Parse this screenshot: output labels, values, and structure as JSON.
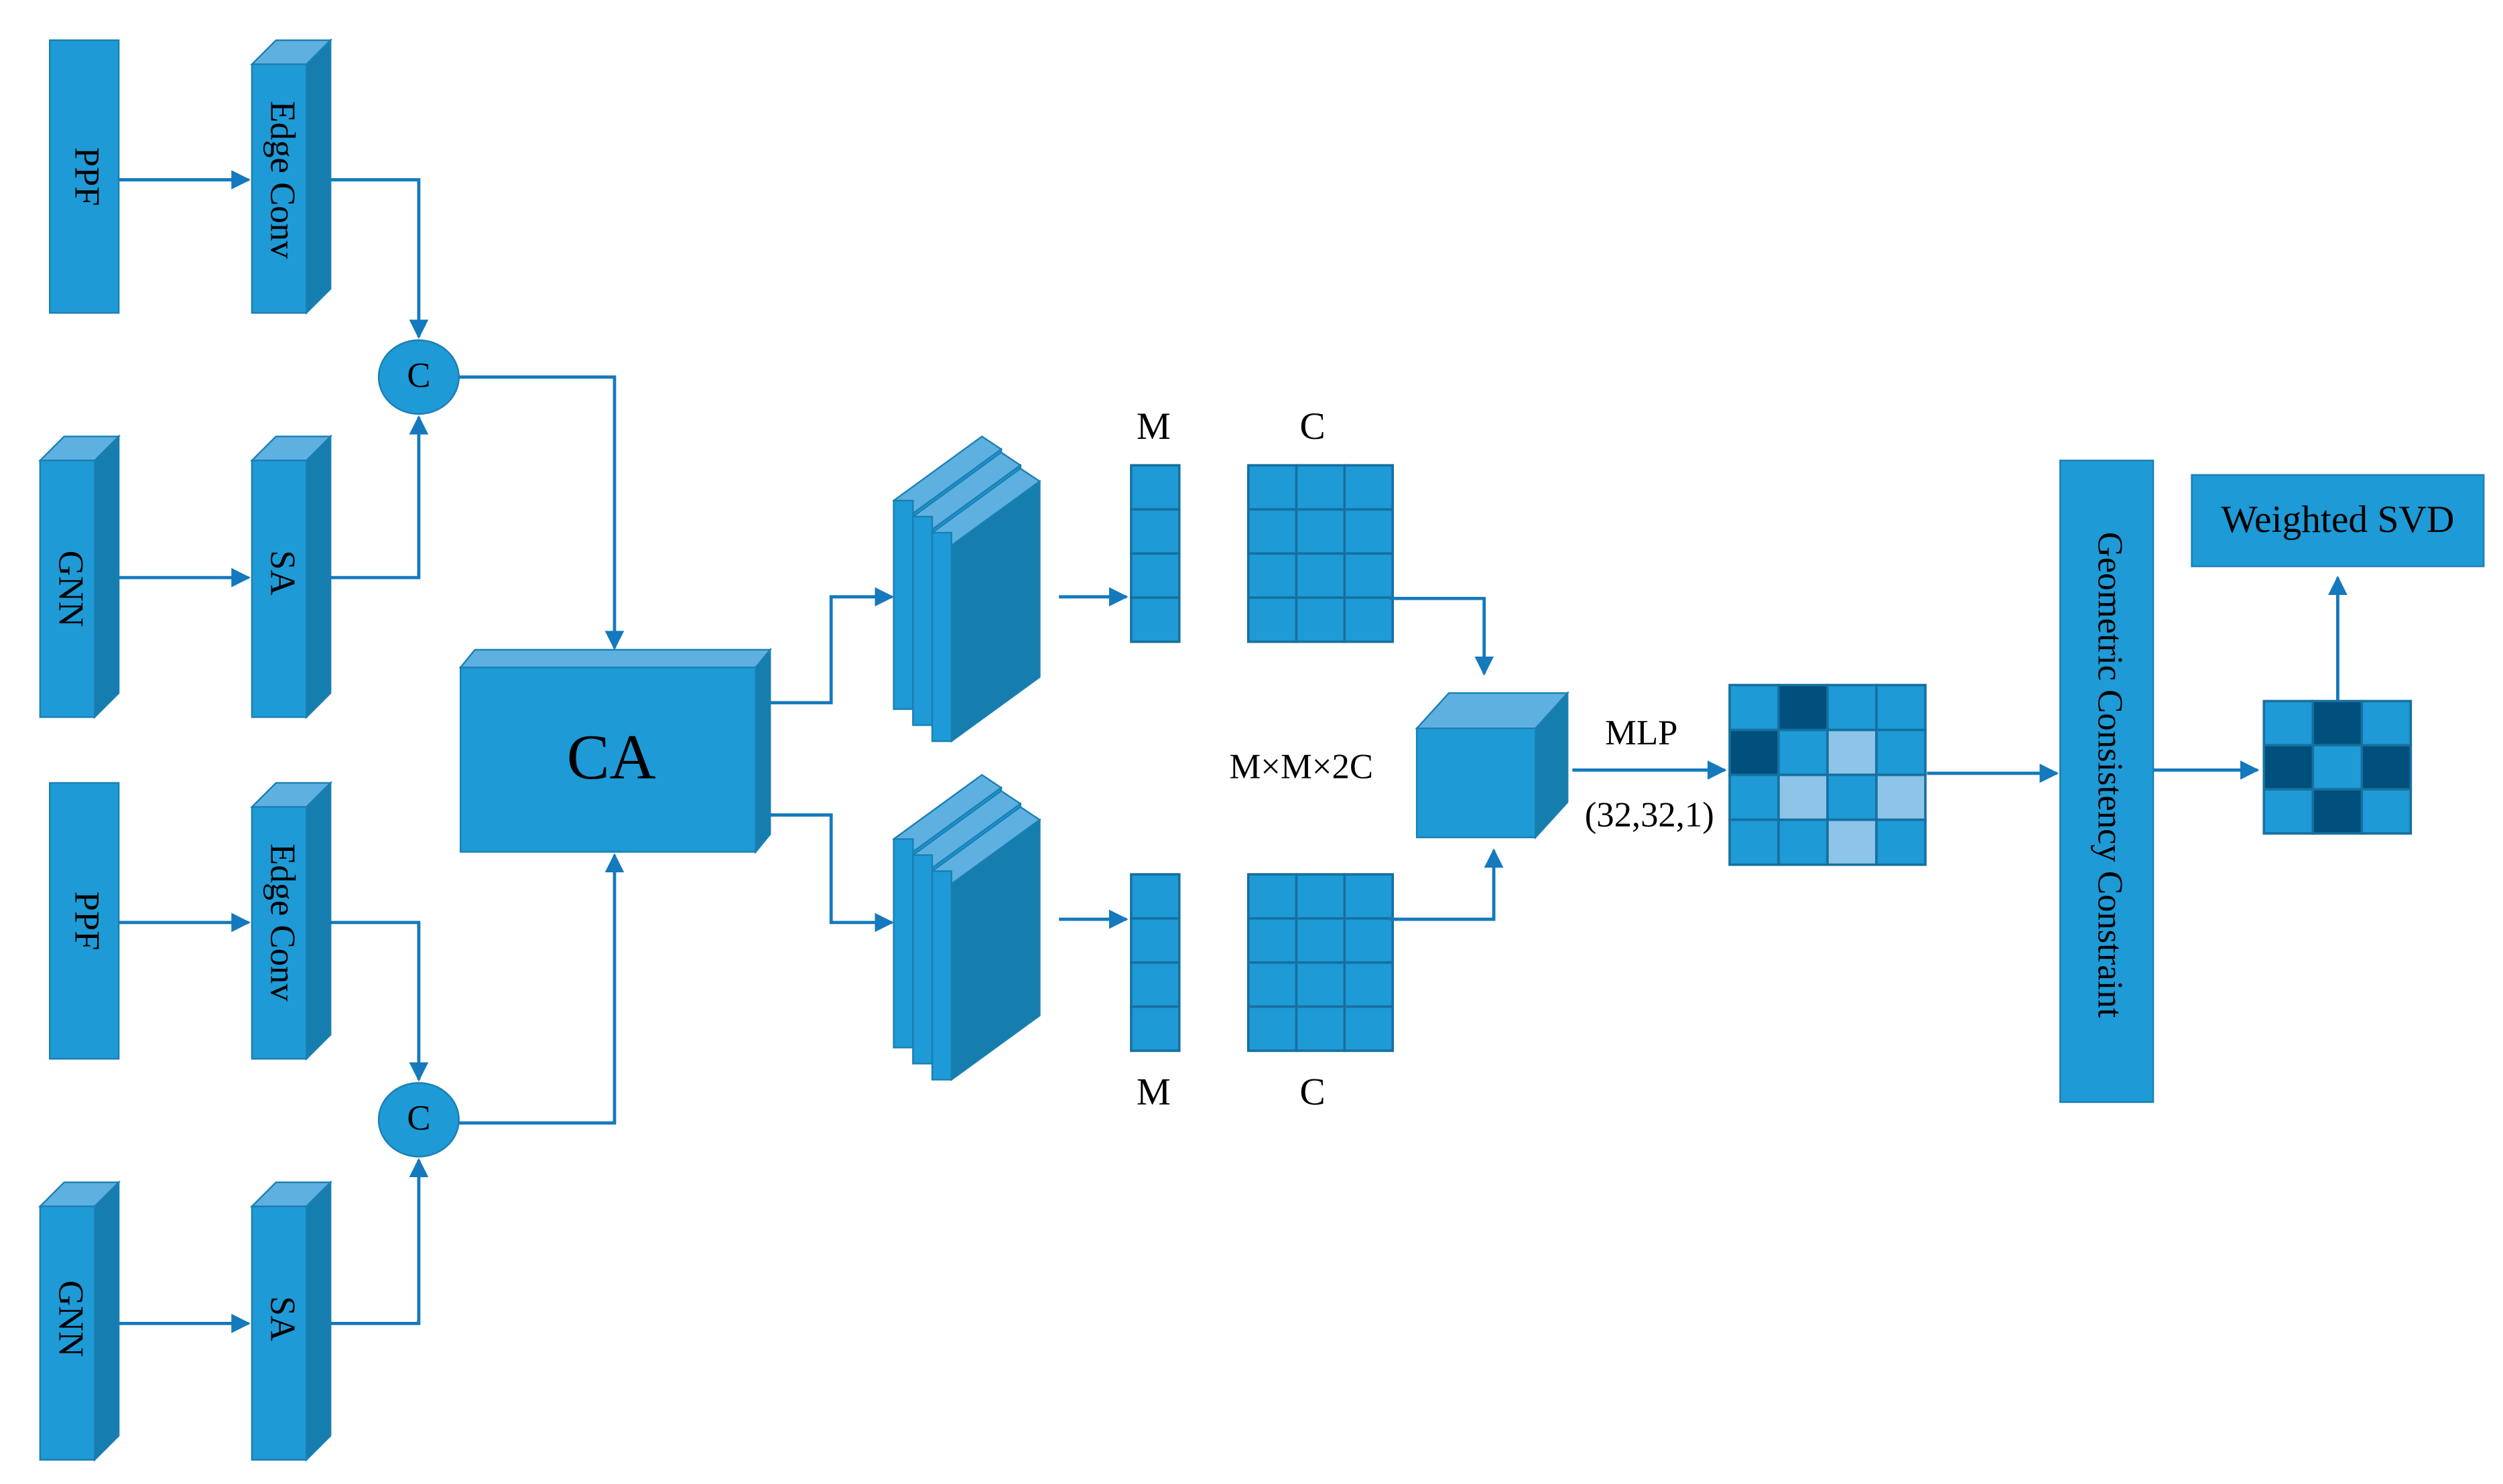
{
  "colors": {
    "face": "#1e9ad6",
    "top": "#5eb0e0",
    "side": "#167eae",
    "line": "#1479bd",
    "cell_mid": "#1e9ad6",
    "cell_dark": "#004f7c",
    "cell_light": "#8ec4e8"
  },
  "branches": [
    {
      "top_input": "PPF",
      "top_block": "Edge Conv",
      "bottom_input": "GNN",
      "bottom_block": "SA",
      "concat": "C"
    },
    {
      "top_input": "PPF",
      "top_block": "Edge Conv",
      "bottom_input": "GNN",
      "bottom_block": "SA",
      "concat": "C"
    }
  ],
  "ca_block": "CA",
  "feature_upper": {
    "m_label": "M",
    "c_label": "C"
  },
  "feature_lower": {
    "m_label": "M",
    "c_label": "C"
  },
  "volume_label": "M×M×2C",
  "mlp_label": "MLP",
  "mlp_shape": "(32,32,1)",
  "score_matrix": [
    [
      "mid",
      "dark",
      "mid",
      "mid"
    ],
    [
      "dark",
      "mid",
      "light",
      "mid"
    ],
    [
      "mid",
      "light",
      "mid",
      "light"
    ],
    [
      "mid",
      "mid",
      "light",
      "mid"
    ]
  ],
  "gcc_block": "Geometric Consistency Constraint",
  "filtered_matrix": [
    [
      "mid",
      "dark",
      "mid"
    ],
    [
      "dark",
      "mid",
      "dark"
    ],
    [
      "mid",
      "dark",
      "mid"
    ]
  ],
  "svd_block": "Weighted SVD"
}
